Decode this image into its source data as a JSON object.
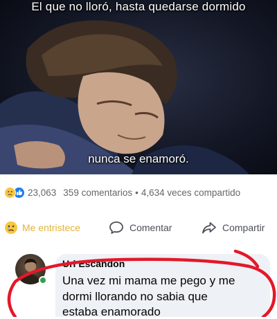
{
  "post": {
    "caption_top": "El que no lloró, hasta quedarse dormido",
    "caption_bottom": "nunca se enamoró."
  },
  "stats": {
    "reaction_icons": [
      "sad-reaction-icon",
      "like-reaction-icon"
    ],
    "reaction_count": "23,063",
    "comments": "359 comentarios",
    "separator": "•",
    "shares": "4,634 veces compartido"
  },
  "actions": {
    "react_label": "Me entristece",
    "comment_label": "Comentar",
    "share_label": "Compartir"
  },
  "comment": {
    "author": "Uri Escandon",
    "lines": [
      "Una vez mi mama me pego y me",
      "dormi llorando no sabia que",
      "estaba enamorado"
    ]
  },
  "colors": {
    "sad_reaction": "#f7c642",
    "like_reaction": "#1a7cf3",
    "highlight_ring": "#e3182a",
    "online_status": "#31a24c"
  }
}
